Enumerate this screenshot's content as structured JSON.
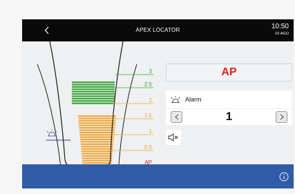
{
  "header": {
    "title": "APEX LOCATOR",
    "time": "10:50",
    "date": "02 AGO"
  },
  "scale": {
    "labels": [
      "3",
      "2.5",
      "2",
      "1.5",
      "1",
      "0.5",
      "AP"
    ],
    "colors": {
      "green": "#3ea53a",
      "orange": "#f0a83c",
      "red": "#e2231a",
      "blue": "#1b3f9c"
    }
  },
  "status": {
    "display": "AP"
  },
  "alarm": {
    "label": "Alarm",
    "value": "1"
  },
  "icons": [
    "back-chevron-icon",
    "bell-icon",
    "minus-icon",
    "plus-icon",
    "speaker-mute-icon",
    "info-icon"
  ],
  "colors": {
    "topbar": "#0a0a0a",
    "bottom_bar": "#2f5ca7",
    "accent_red": "#e2231a"
  }
}
